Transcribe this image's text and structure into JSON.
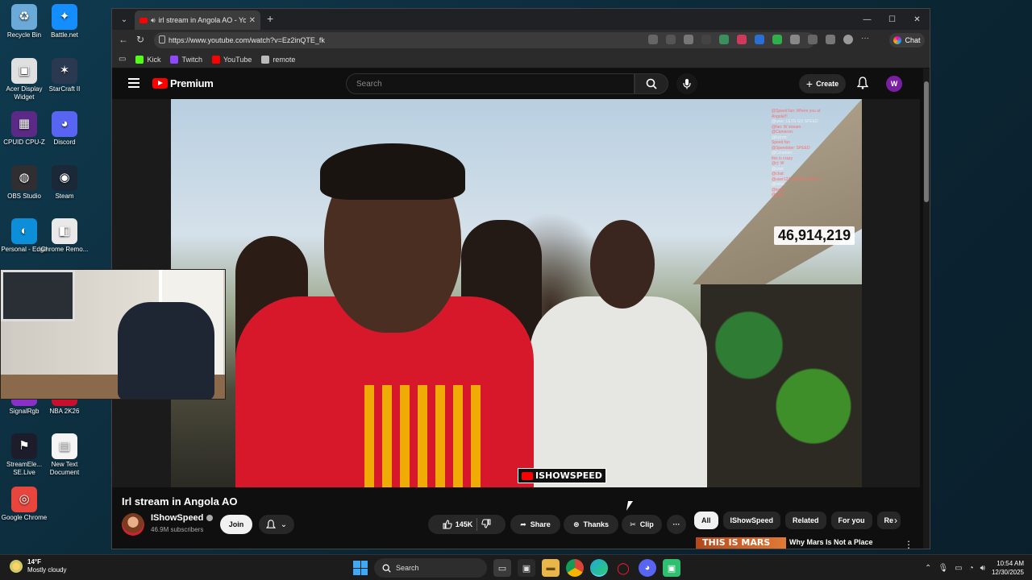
{
  "desktop": {
    "icons": [
      {
        "label": "Recycle Bin",
        "glyph": "♻",
        "color": "#6aa9d8"
      },
      {
        "label": "Battle.net",
        "glyph": "✦",
        "color": "#148eff"
      },
      {
        "label": "Acer Display Widget",
        "glyph": "▣",
        "color": "#e0e0e0"
      },
      {
        "label": "StarCraft II",
        "glyph": "✶",
        "color": "#2a3950"
      },
      {
        "label": "CPUID CPU-Z",
        "glyph": "▦",
        "color": "#5b2a86"
      },
      {
        "label": "Discord",
        "glyph": "◕",
        "color": "#5865f2"
      },
      {
        "label": "OBS Studio",
        "glyph": "◍",
        "color": "#302e31"
      },
      {
        "label": "Steam",
        "glyph": "◉",
        "color": "#1b2838"
      },
      {
        "label": "Personal - Edge",
        "glyph": "◐",
        "color": "#0c8fd8"
      },
      {
        "label": "Chrome Remo...",
        "glyph": "◧",
        "color": "#e9e9e9"
      },
      {
        "label": "SignalRgb",
        "glyph": "◆",
        "color": "#8b2fc9"
      },
      {
        "label": "NBA 2K26",
        "glyph": "▰",
        "color": "#c8102e"
      },
      {
        "label": "StreamEle... SE.Live",
        "glyph": "⚑",
        "color": "#1c1c2a"
      },
      {
        "label": "New Text Document",
        "glyph": "▤",
        "color": "#f5f5f5"
      },
      {
        "label": "Google Chrome",
        "glyph": "◎",
        "color": "#e8453c"
      }
    ]
  },
  "browser": {
    "tab_title": "irl stream in Angola AO - YouT",
    "url": "https://www.youtube.com/watch?v=Ez2inQTE_fk",
    "chat_label": "Chat",
    "favorites": [
      {
        "label": "Kick",
        "color": "#53fc18"
      },
      {
        "label": "Twitch",
        "color": "#9146ff"
      },
      {
        "label": "YouTube",
        "color": "#ff0000"
      },
      {
        "label": "remote",
        "color": "#bbbbbb"
      }
    ]
  },
  "youtube": {
    "logo_text": "Premium",
    "search_placeholder": "Search",
    "create_label": "Create",
    "avatar_letter": "W",
    "video": {
      "chat_lines": [
        "@Speed fan: Where you at",
        "Angola!!!",
        "@user: LETS GO SPEED",
        "@fan: W stream",
        "@Cameron:",
        "@kylorb:",
        "Speed fan",
        "@Speedster: SPEED",
        "@Cinamon:",
        "this is crazy",
        "@rj: W",
        "@user:",
        "@chat:",
        "@user123: Speed come to",
        "@mike:",
        "@lena:",
        "@user: ..."
      ],
      "viewer_counter": "46,914,219",
      "watermark": "ISHOWSPEED"
    },
    "title": "Irl stream in Angola AO",
    "channel": {
      "name": "IShowSpeed",
      "subscribers": "46.9M subscribers",
      "join_label": "Join"
    },
    "actions": {
      "likes": "145K",
      "share": "Share",
      "thanks": "Thanks",
      "clip": "Clip"
    },
    "chips": [
      "All",
      "IShowSpeed",
      "Related",
      "For you",
      "Re"
    ],
    "recommended": {
      "thumb_text": "THIS IS MARS",
      "title": "Why Mars Is Not a Place Humans Can Actually Live"
    }
  },
  "taskbar": {
    "weather_temp": "14°F",
    "weather_desc": "Mostly cloudy",
    "search_label": "Search",
    "time": "10:54 AM",
    "date": "12/30/2025"
  }
}
